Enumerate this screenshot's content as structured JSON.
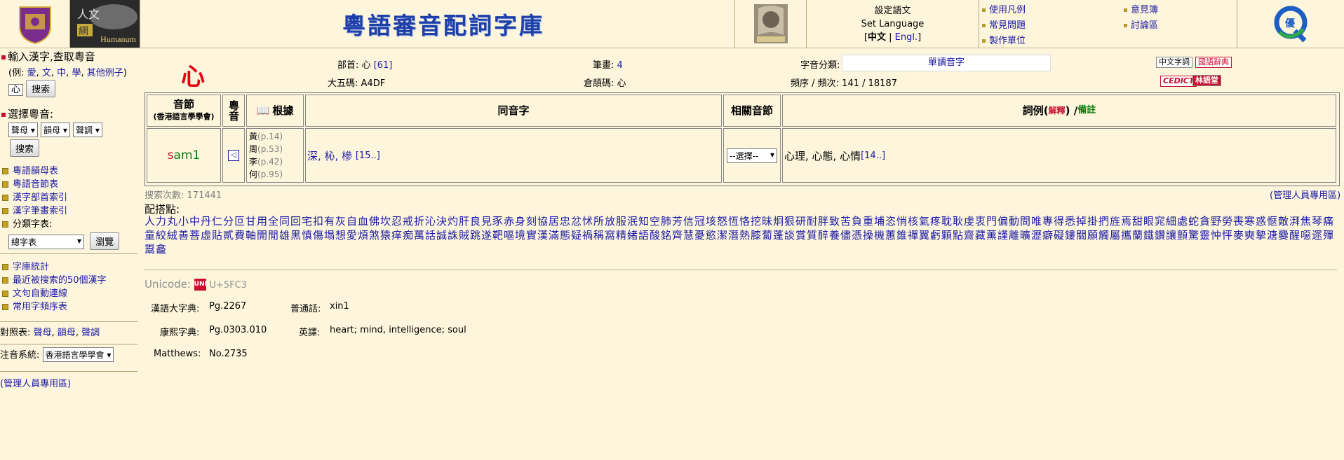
{
  "banner": {
    "site_title": "粵語審音配詞字庫",
    "humanum_label": "Humanum",
    "lang": {
      "title": "設定語文",
      "subtitle": "Set Language",
      "bracket_open": "[",
      "current": "中文",
      "sep": " | ",
      "alt": "Engl.",
      "bracket_close": "]"
    },
    "menu": [
      {
        "label": "使用凡例"
      },
      {
        "label": "常見問題"
      },
      {
        "label": "製作單位"
      },
      {
        "label": "意見簿"
      },
      {
        "label": "討論區"
      }
    ]
  },
  "sidebar": {
    "input_heading": "輸入漢字,查取粵音",
    "examples_prefix": "(例: ",
    "examples": [
      "愛",
      "文",
      "中",
      "學"
    ],
    "examples_more": "其他例子",
    "examples_suffix": ")",
    "char_input_value": "心",
    "search_button": "搜索",
    "select_heading": "選擇粵音:",
    "selects": [
      "聲母",
      "韻母",
      "聲調"
    ],
    "search_button2": "搜索",
    "links1": [
      "粵語韻母表",
      "粵語音節表",
      "漢字部首索引",
      "漢字筆畫索引"
    ],
    "category_label": "分類字表:",
    "category_select": "總字表",
    "browse_button": "瀏覽",
    "links2": [
      "字庫統計",
      "最近被搜索的50個漢字",
      "文句自動連線",
      "常用字頻序表"
    ],
    "compare_prefix": "對照表: ",
    "compare_links": [
      "聲母",
      "韻母",
      "聲調"
    ],
    "system_label": "注音系統:",
    "system_select": "香港語言學學會",
    "admin_link": "管理人員專用區"
  },
  "info": {
    "char": "心",
    "radical_label": "部首:",
    "radical_value": "心",
    "radical_ref": "[61]",
    "big5_label": "大五碼:",
    "big5_value": "A4DF",
    "strokes_label": "筆畫:",
    "strokes_value": "4",
    "cangjie_label": "倉頡碼:",
    "cangjie_value": "心",
    "category_label": "字音分類:",
    "category_value": "單讀音字",
    "freq_label": "頻序 / 頻次:",
    "freq_value": "141 / 18187",
    "badges": [
      "中文字詞",
      "國語辭典",
      "CEDICT",
      "林語堂"
    ]
  },
  "table": {
    "headers": {
      "syllable": "音節",
      "syllable_sub": "(香港語言學學會)",
      "sound": "粵音",
      "source": "根據",
      "homophones": "同音字",
      "related": "相關音節",
      "examples_main": "詞例(",
      "examples_explain": "解釋",
      "examples_close": ") / ",
      "examples_note": "備註"
    },
    "row": {
      "syllable_initial": "s",
      "syllable_final": "am1",
      "sources": [
        {
          "name": "黃",
          "page": "(p.14)"
        },
        {
          "name": "周",
          "page": "(p.53)"
        },
        {
          "name": "李",
          "page": "(p.42)"
        },
        {
          "name": "何",
          "page": "(p.95)"
        }
      ],
      "homophones": "深, 杺, 槮",
      "homophones_more": "[15..]",
      "related_select": "--選擇--",
      "examples": "心理, 心態, 心情",
      "examples_more": "[14..]"
    }
  },
  "stats": {
    "search_count_label": "搜索次數:",
    "search_count": "171441",
    "admin_link": "(管理人員專用區)"
  },
  "pairing": {
    "label": "配搭點:",
    "chars": "人力丸小中丹仁分叵甘用全同回宅扣有灰自血佛坎忍戒折沁決灼肝良見豕赤身刻協居忠忿怵所放服泯知空肺芳信冠垓怒恆恪挖昧炯狠研耐胖致苦負重埔恣悄核氣疼耽耿虔衷門偏動問唯專得悉掉掛捫旌焉甜眼窕細處蛇貪野勞喪寒惑愜敵湃焦琴痛童絞絨善菩虛貼貳費軸開閒雄黑慎傷塌想愛煩煞猿痒痴萬話誠誅賊跳遂靶嘔境實漢滿態疑禍稱窩精緒語酸銘齊慧憂慾潔潛熱膝蔔蓬談賞質醉養儘憑操機蕙錐禪翼虧顆點齋藏薰謹離曠瀝癖礙鏤關願觸屬攜蘭鐵鑽讓顫驚靈忡怦麥奭摯溏爨醒噁遝殫鬻龕"
  },
  "unicode": {
    "label": "Unicode:",
    "icon": "UNI",
    "code": "U+5FC3"
  },
  "details": {
    "hanyu_label": "漢語大字典:",
    "hanyu_value": "Pg.2267",
    "putonghua_label": "普通話:",
    "putonghua_value": "xin1",
    "kangxi_label": "康熙字典:",
    "kangxi_value": "Pg.0303.010",
    "english_label": "英譯:",
    "english_value": "heart; mind, intelligence; soul",
    "matthews_label": "Matthews:",
    "matthews_value": "No.2735"
  }
}
